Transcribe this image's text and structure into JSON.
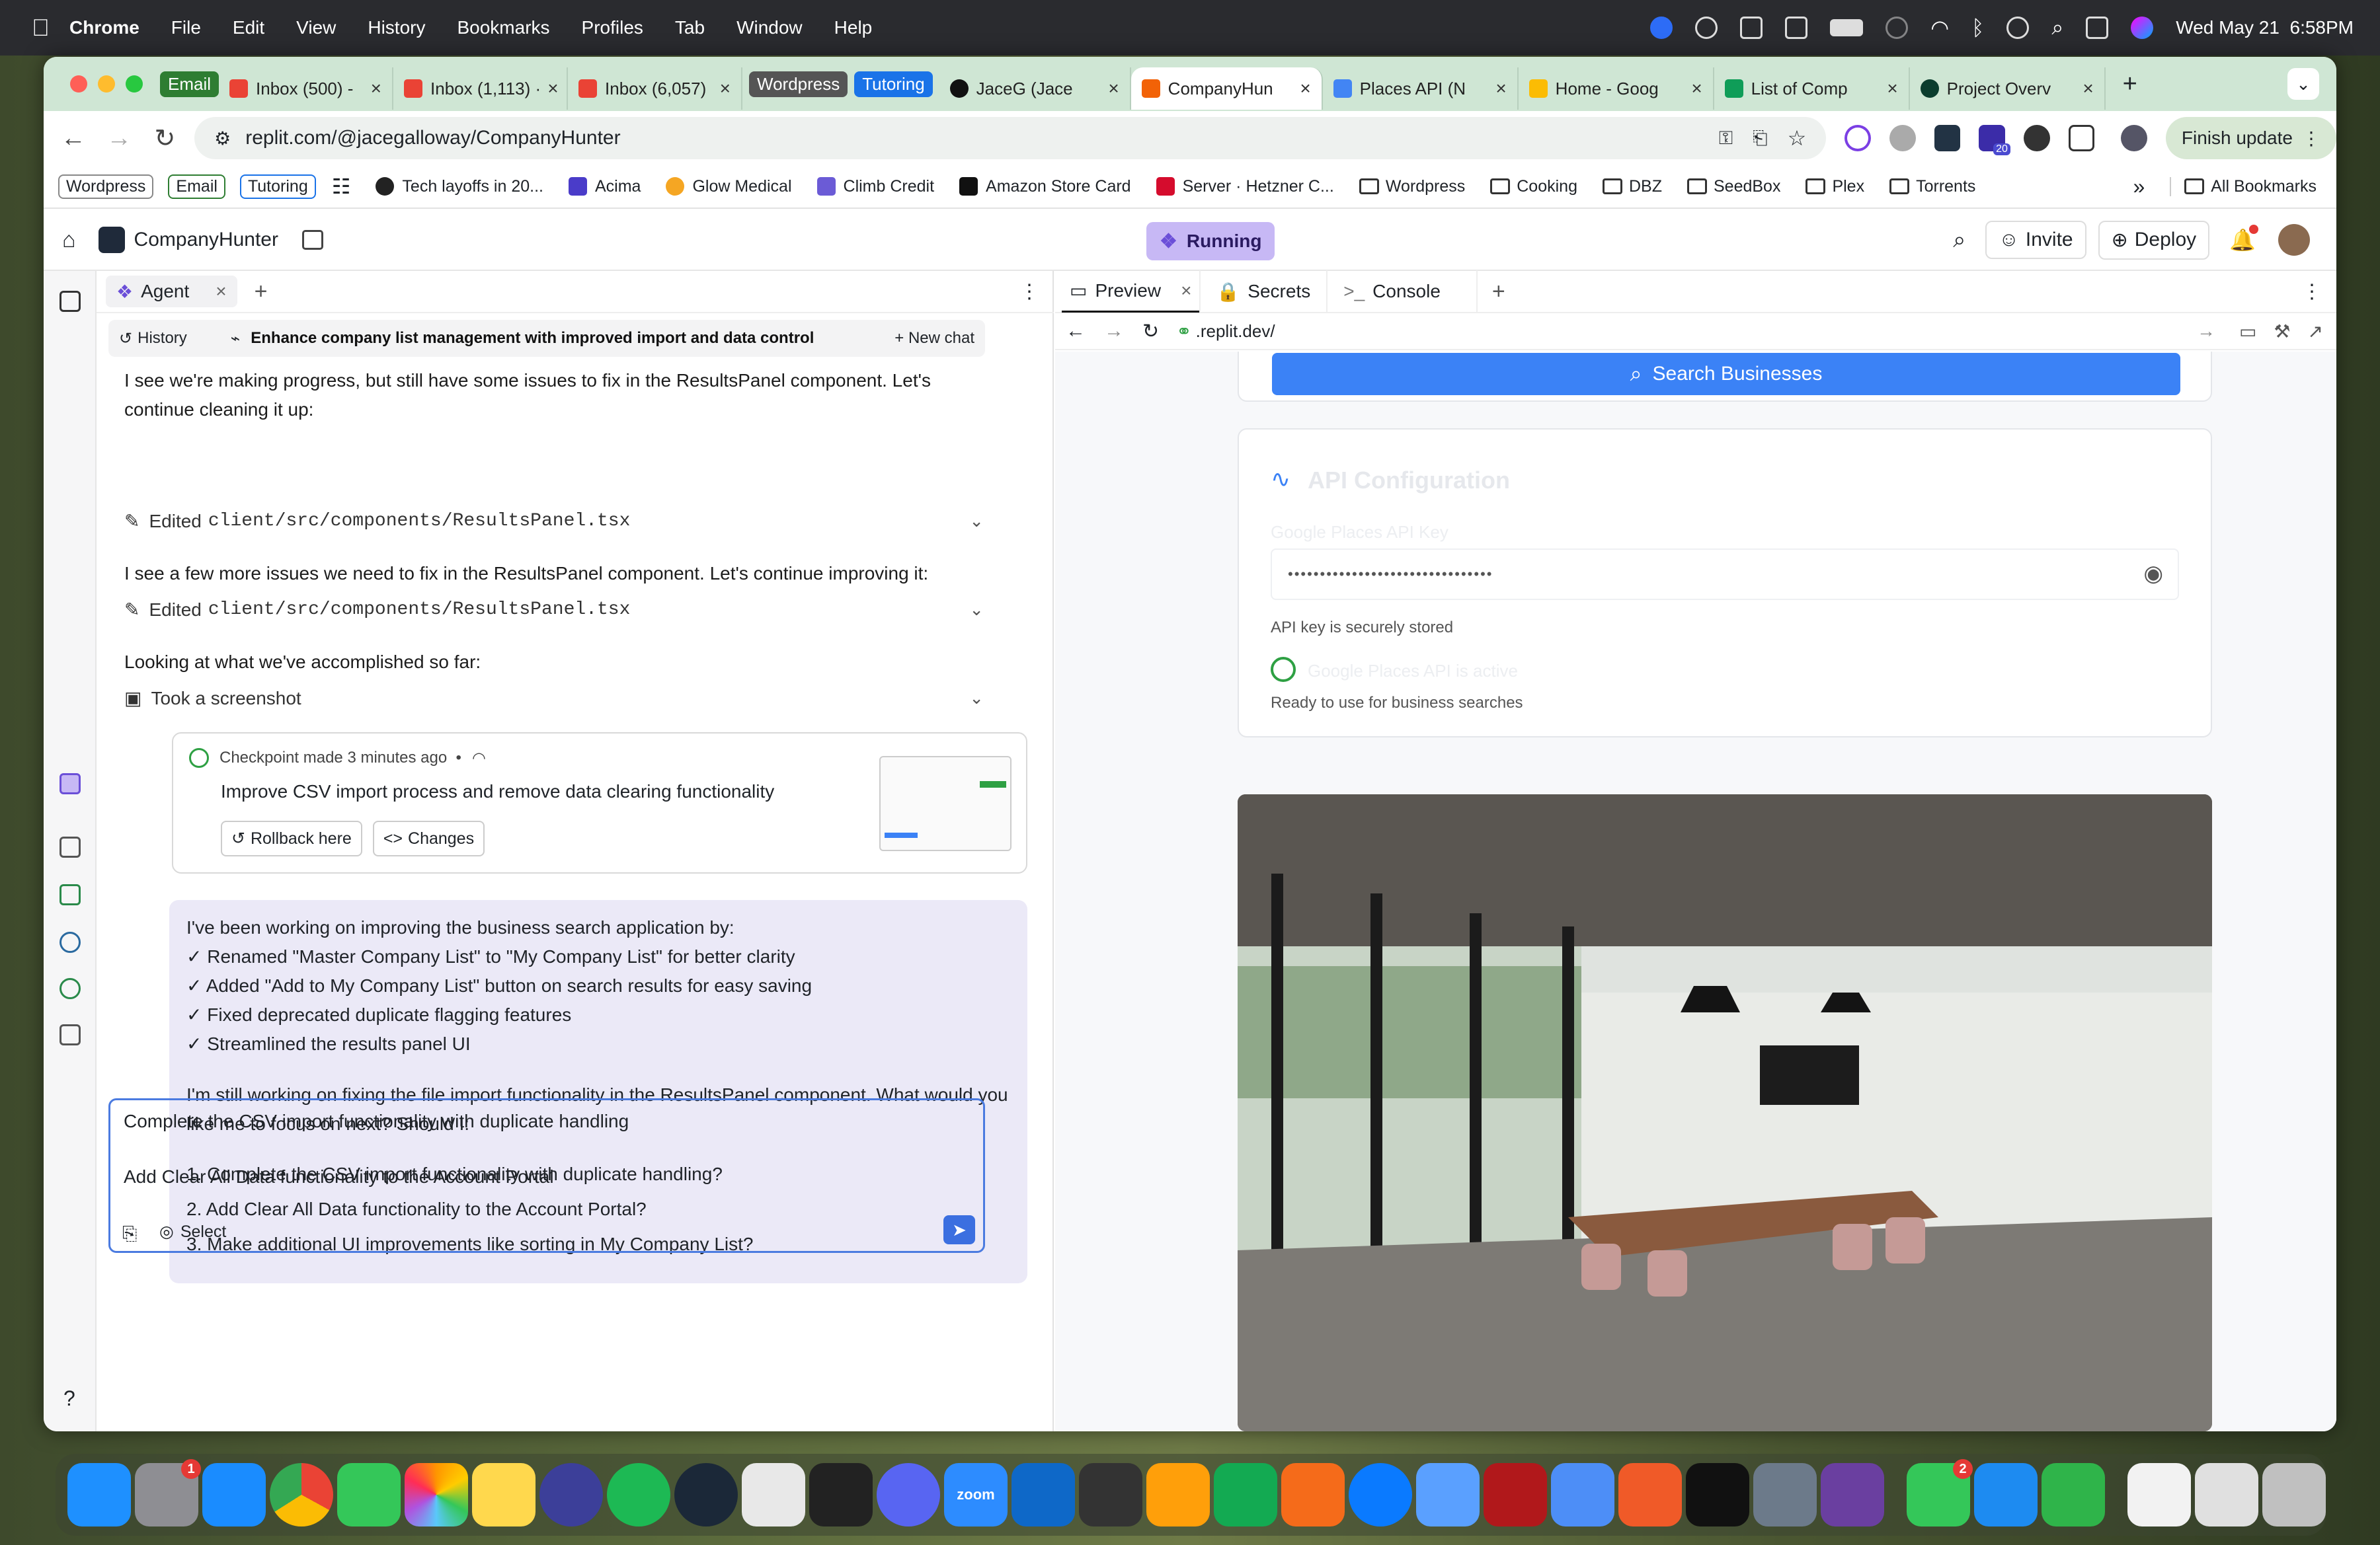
{
  "menubar": {
    "app": "Chrome",
    "items": [
      "File",
      "Edit",
      "View",
      "History",
      "Bookmarks",
      "Profiles",
      "Tab",
      "Window",
      "Help"
    ],
    "datetime": "Wed May 21  6:58PM"
  },
  "tabs": [
    {
      "tag": "Email",
      "tag_color": "#2e7d32"
    },
    {
      "label": "Inbox (500) -"
    },
    {
      "label": "Inbox (1,113) ·"
    },
    {
      "label": "Inbox (6,057)"
    },
    {
      "tag": "Wordpress",
      "tag_color": "#555555"
    },
    {
      "tag": "Tutoring",
      "tag_color": "#1a73e8"
    },
    {
      "label": "JaceG (Jace"
    },
    {
      "label": "CompanyHun",
      "active": true
    },
    {
      "label": "Places API (N"
    },
    {
      "label": "Home - Goog"
    },
    {
      "label": "List of Comp"
    },
    {
      "label": "Project Overv"
    }
  ],
  "address": {
    "url": "replit.com/@jacegalloway/CompanyHunter",
    "finish": "Finish update",
    "badge": "20"
  },
  "bookmarks": {
    "tags": [
      "Wordpress",
      "Email",
      "Tutoring"
    ],
    "items": [
      "Tech layoffs in 20...",
      "Acima",
      "Glow Medical",
      "Climb Credit",
      "Amazon Store Card",
      "Server · Hetzner C..."
    ],
    "folders": [
      "Wordpress",
      "Cooking",
      "DBZ",
      "SeedBox",
      "Plex",
      "Torrents"
    ],
    "overflow": "»",
    "all": "All Bookmarks"
  },
  "replit": {
    "project": "CompanyHunter",
    "status": "Running",
    "invite": "Invite",
    "deploy": "Deploy",
    "notif": "?"
  },
  "agent": {
    "tab": "Agent",
    "history": "History",
    "chat_title": "Enhance company list management with improved import and data control",
    "new_chat": "+ New chat",
    "msg1": "I see we're making progress, but still have some issues to fix in the ResultsPanel component. Let's continue cleaning it up:",
    "edit_prefix": "Edited",
    "edit_file": "client/src/components/ResultsPanel.tsx",
    "msg2": "I see a few more issues we need to fix in the ResultsPanel component. Let's continue improving it:",
    "msg3": "Looking at what we've accomplished so far:",
    "screenshot": "Took a screenshot",
    "checkpoint_meta": "Checkpoint made 3 minutes ago  •",
    "checkpoint_title": "Improve CSV import process and remove data clearing functionality",
    "rollback": "Rollback here",
    "changes": "Changes",
    "summary_intro": "I've been working on improving the business search application by:",
    "summary_points": [
      "✓ Renamed \"Master Company List\" to \"My Company List\" for better clarity",
      "✓ Added \"Add to My Company List\" button on search results for easy saving",
      "✓ Fixed deprecated duplicate flagging features",
      "✓ Streamlined the results panel UI"
    ],
    "summary_question": "I'm still working on fixing the file import functionality in the ResultsPanel component. What would you like me to focus on next? Should I:",
    "options": [
      "1. Complete the CSV import functionality with duplicate handling?",
      "2. Add Clear All Data functionality to the Account Portal?",
      "3. Make additional UI improvements like sorting in My Company List?"
    ],
    "input_line1": "Complete the CSV import functionality with duplicate handling",
    "input_line2": "Add Clear All Data functionality to the Account Portal",
    "select": "Select"
  },
  "preview": {
    "tabs": [
      "Preview",
      "Secrets",
      "Console"
    ],
    "url": ".replit.dev/",
    "search_button": "Search Businesses",
    "api_title": "API Configuration",
    "api_key_label": "Google Places API Key",
    "api_key_value": "••••••••••••••••••••••••••••••••",
    "api_note": "API key is securely stored",
    "api_status": "Google Places API is active",
    "api_ready": "Ready to use for business searches"
  },
  "dock": {
    "settings_badge": "1",
    "facetime_badge": "2",
    "zoom": "zoom",
    "colors": [
      "#1e90ff",
      "#8e8e93",
      "#1a8cff",
      "#ffffff",
      "#34c759",
      "#f2f2f2",
      "#ffd84d",
      "#3c3f99",
      "#1db954",
      "#1b2838",
      "#e8e8e8",
      "#222222",
      "#5865f2",
      "#2d8cff",
      "#0e68c8",
      "#333333",
      "#ff9f0a",
      "#13aa52",
      "#f56b1a",
      "#0a7aff",
      "#5aa0ff",
      "#b1181b",
      "#4d8ef7",
      "#f05a28",
      "#111111",
      "#6c7a8a",
      "#6a3fa0",
      "#34c759",
      "#1d8bf1",
      "#2fb44a",
      "#f2f2f2",
      "#e0e0e0",
      "#c0c0c0"
    ]
  }
}
